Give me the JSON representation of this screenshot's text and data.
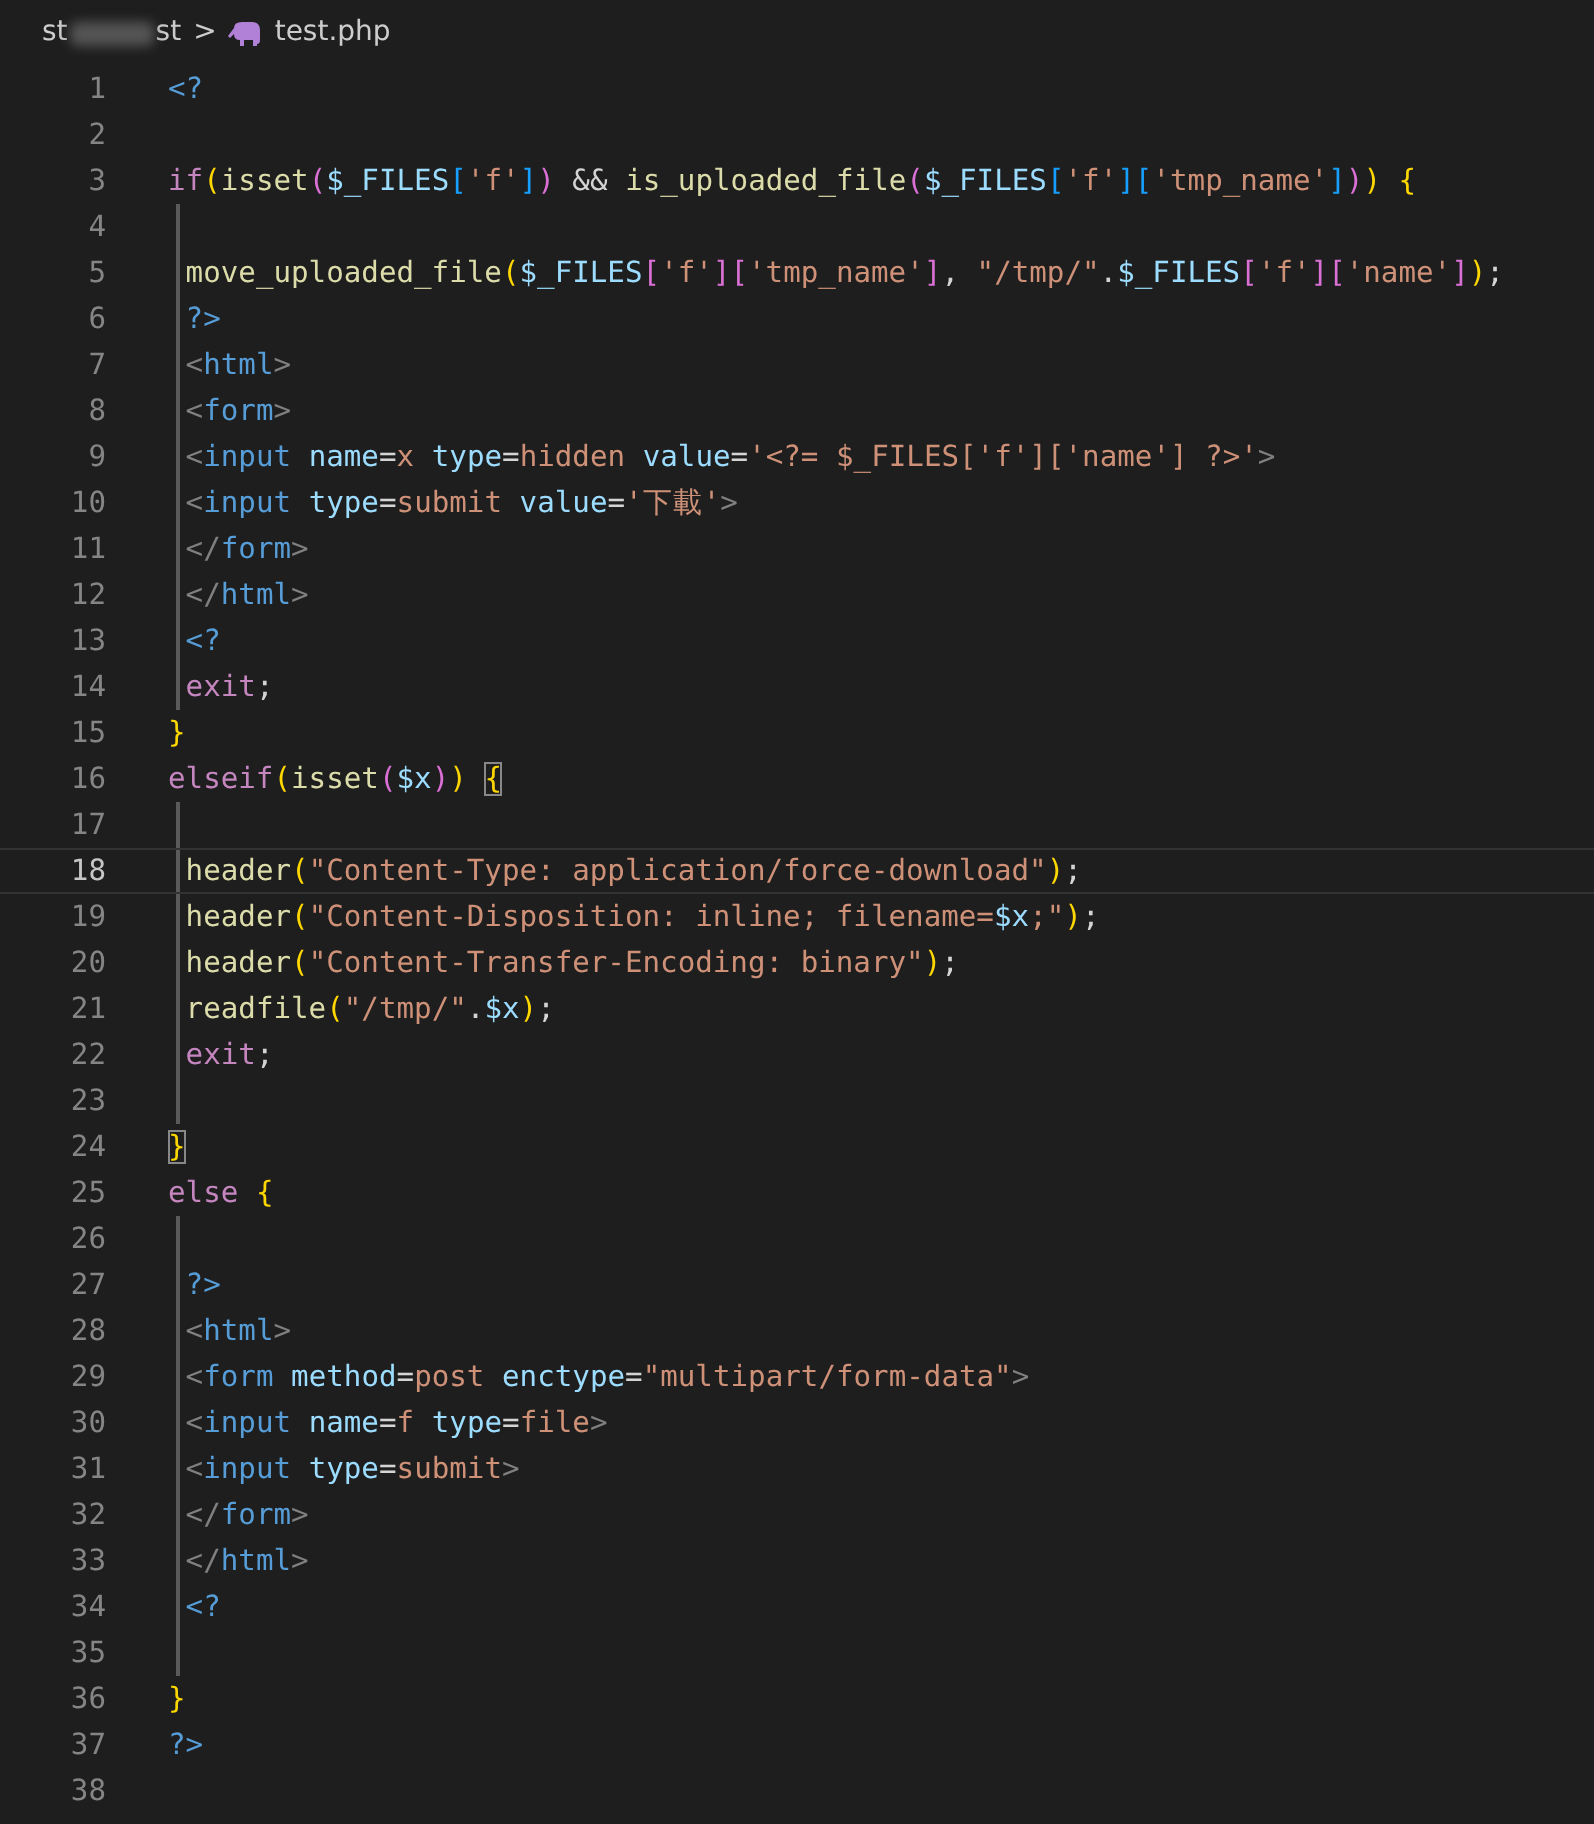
{
  "breadcrumb": {
    "folder_start": "st",
    "folder_end": "st",
    "separator": ">",
    "file": "test.php"
  },
  "lines": [
    {
      "number": "1",
      "code": "<?",
      "current": false,
      "guide": false
    },
    {
      "number": "2",
      "current": false,
      "guide": false
    },
    {
      "number": "3",
      "code": "if(isset($_FILES['f']) && is_uploaded_file($_FILES['f']['tmp_name'])) {",
      "current": false,
      "guide": false,
      "matched_bracket": false
    },
    {
      "number": "4",
      "current": false,
      "guide": true
    },
    {
      "number": "5",
      "code": " move_uploaded_file($_FILES['f']['tmp_name'], \"/tmp/\".$_FILES['f']['name']);",
      "current": false,
      "guide": true
    },
    {
      "number": "6",
      "code": " ?>",
      "current": false,
      "guide": true
    },
    {
      "number": "7",
      "code": " <html>",
      "current": false,
      "guide": true
    },
    {
      "number": "8",
      "code": " <form>",
      "current": false,
      "guide": true
    },
    {
      "number": "9",
      "code": " <input name=x type=hidden value='<?= $_FILES['f']['name'] ?>'>",
      "current": false,
      "guide": true
    },
    {
      "number": "10",
      "code": " <input type=submit value='下載'>",
      "current": false,
      "guide": true
    },
    {
      "number": "11",
      "code": " </form>",
      "current": false,
      "guide": true
    },
    {
      "number": "12",
      "code": " </html>",
      "current": false,
      "guide": true
    },
    {
      "number": "13",
      "code": " <?",
      "current": false,
      "guide": true
    },
    {
      "number": "14",
      "code": " exit;",
      "current": false,
      "guide": true
    },
    {
      "number": "15",
      "code": "}",
      "current": false,
      "guide": false,
      "matched_bracket": false
    },
    {
      "number": "16",
      "code": "elseif(isset($x)) {",
      "current": false,
      "guide": false,
      "matched_bracket": true
    },
    {
      "number": "17",
      "current": false,
      "guide": true
    },
    {
      "number": "18",
      "code": " header(\"Content-Type: application/force-download\");",
      "current": true,
      "guide": true
    },
    {
      "number": "19",
      "code": " header(\"Content-Disposition: inline; filename=$x;\");",
      "current": false,
      "guide": true
    },
    {
      "number": "20",
      "code": " header(\"Content-Transfer-Encoding: binary\");",
      "current": false,
      "guide": true
    },
    {
      "number": "21",
      "code": " readfile(\"/tmp/\".$x);",
      "current": false,
      "guide": true
    },
    {
      "number": "22",
      "code": " exit;",
      "current": false,
      "guide": true
    },
    {
      "number": "23",
      "current": false,
      "guide": true
    },
    {
      "number": "24",
      "code": "}",
      "current": false,
      "guide": false,
      "matched_bracket": true
    },
    {
      "number": "25",
      "code": "else {",
      "current": false,
      "guide": false,
      "matched_bracket": false
    },
    {
      "number": "26",
      "current": false,
      "guide": true
    },
    {
      "number": "27",
      "code": " ?>",
      "current": false,
      "guide": true
    },
    {
      "number": "28",
      "code": " <html>",
      "current": false,
      "guide": true
    },
    {
      "number": "29",
      "code": " <form method=post enctype=\"multipart/form-data\">",
      "current": false,
      "guide": true
    },
    {
      "number": "30",
      "code": " <input name=f type=file>",
      "current": false,
      "guide": true
    },
    {
      "number": "31",
      "code": " <input type=submit>",
      "current": false,
      "guide": true
    },
    {
      "number": "32",
      "code": " </form>",
      "current": false,
      "guide": true
    },
    {
      "number": "33",
      "code": " </html>",
      "current": false,
      "guide": true
    },
    {
      "number": "34",
      "code": " <?",
      "current": false,
      "guide": true
    },
    {
      "number": "35",
      "current": false,
      "guide": true
    },
    {
      "number": "36",
      "code": "}",
      "current": false,
      "guide": false,
      "matched_bracket": false
    },
    {
      "number": "37",
      "code": "?>",
      "current": false,
      "guide": false
    },
    {
      "number": "38",
      "current": false,
      "guide": false
    }
  ]
}
